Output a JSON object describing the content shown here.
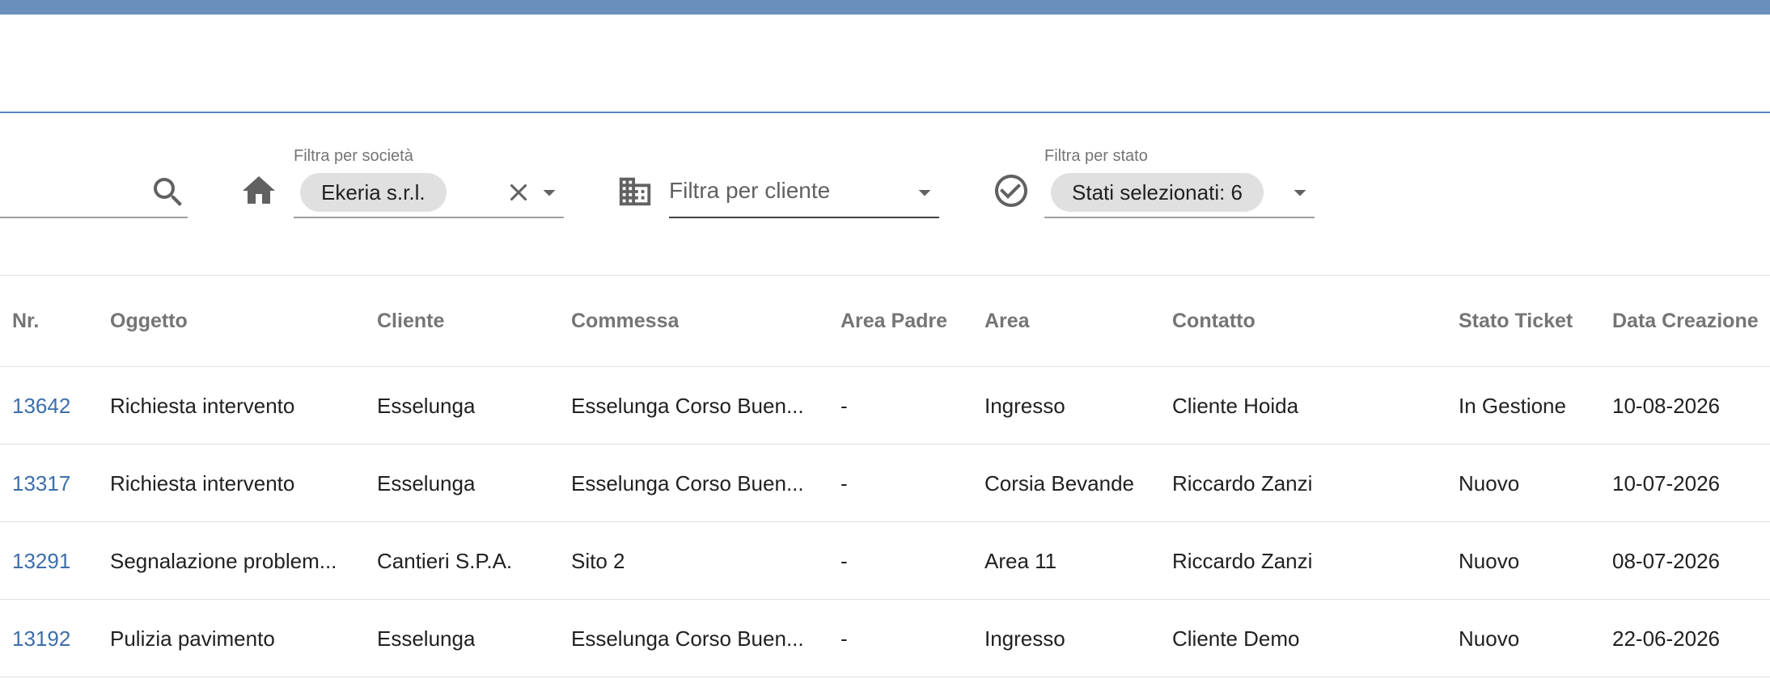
{
  "colors": {
    "topbar": "#6a8fbd",
    "accent_line": "#5b86c4",
    "link": "#3d6eaa",
    "chip_bg": "#e0e0e0"
  },
  "icons": {
    "search": "search-icon",
    "home": "home-icon",
    "clear": "close-icon",
    "dropdown": "arrow-drop-down-icon",
    "building": "building-icon",
    "status": "check-circle-icon"
  },
  "filters": {
    "company": {
      "label": "Filtra per società",
      "value": "Ekeria s.r.l."
    },
    "client": {
      "placeholder": "Filtra per cliente"
    },
    "status": {
      "label": "Filtra per stato",
      "value": "Stati selezionati: 6"
    }
  },
  "table": {
    "headers": [
      "Nr.",
      "Oggetto",
      "Cliente",
      "Commessa",
      "Area Padre",
      "Area",
      "Contatto",
      "Stato Ticket",
      "Data Creazione"
    ],
    "rows": [
      [
        "13642",
        "Richiesta intervento",
        "Esselunga",
        "Esselunga Corso Buen...",
        "-",
        "Ingresso",
        "Cliente Hoida",
        "In Gestione",
        "10-08-2026"
      ],
      [
        "13317",
        "Richiesta intervento",
        "Esselunga",
        "Esselunga Corso Buen...",
        "-",
        "Corsia Bevande",
        "Riccardo Zanzi",
        "Nuovo",
        "10-07-2026"
      ],
      [
        "13291",
        "Segnalazione problem...",
        "Cantieri S.P.A.",
        "Sito 2",
        "-",
        "Area 11",
        "Riccardo Zanzi",
        "Nuovo",
        "08-07-2026"
      ],
      [
        "13192",
        "Pulizia pavimento",
        "Esselunga",
        "Esselunga Corso Buen...",
        "-",
        "Ingresso",
        "Cliente Demo",
        "Nuovo",
        "22-06-2026"
      ]
    ]
  }
}
